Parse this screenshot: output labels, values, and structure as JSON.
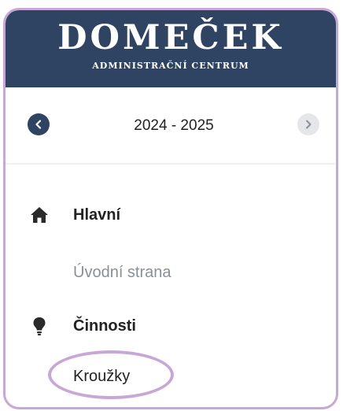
{
  "brand": {
    "title": "Domeček",
    "subtitle": "Administrační centrum"
  },
  "year_selector": {
    "value": "2024 - 2025",
    "prev_icon": "chevron-left-icon",
    "next_icon": "chevron-right-icon"
  },
  "menu": {
    "sections": [
      {
        "label": "Hlavní",
        "icon": "home-icon",
        "items": [
          {
            "label": "Úvodní strana",
            "state": "muted"
          }
        ]
      },
      {
        "label": "Činnosti",
        "icon": "lightbulb-icon",
        "items": [
          {
            "label": "Kroužky",
            "state": "highlighted"
          }
        ]
      }
    ]
  },
  "colors": {
    "header_bg": "#2f4462",
    "highlight": "#c7a6d8",
    "muted_text": "#8a8f97"
  }
}
